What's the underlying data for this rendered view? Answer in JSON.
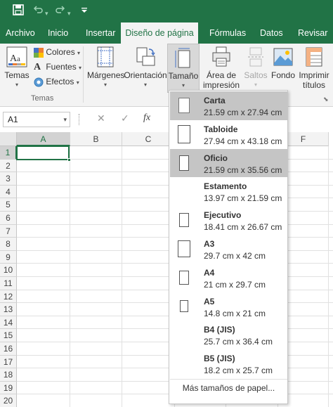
{
  "qat": {
    "save_icon": "save-icon",
    "undo_icon": "undo-icon",
    "redo_icon": "redo-icon",
    "customize_icon": "customize-icon"
  },
  "tabs": [
    "Archivo",
    "Inicio",
    "Insertar",
    "Diseño de página",
    "Fórmulas",
    "Datos",
    "Revisar"
  ],
  "active_tab": "Diseño de página",
  "ribbon": {
    "temas": {
      "label": "Temas"
    },
    "colores": "Colores",
    "fuentes": "Fuentes",
    "efectos": "Efectos",
    "group_temas": "Temas",
    "margenes": "Márgenes",
    "orientacion": "Orientación",
    "tamano": "Tamaño",
    "area_line1": "Área de",
    "area_line2": "impresión",
    "saltos": "Saltos",
    "fondo": "Fondo",
    "imprimir_line1": "Imprimir",
    "imprimir_line2": "títulos"
  },
  "formula_bar": {
    "name_box": "A1",
    "fx": "fx",
    "cancel": "✕",
    "enter": "✓"
  },
  "columns": [
    "A",
    "B",
    "C",
    "D",
    "E",
    "F"
  ],
  "rows": [
    "1",
    "2",
    "3",
    "4",
    "5",
    "6",
    "7",
    "8",
    "9",
    "10",
    "11",
    "12",
    "13",
    "14",
    "15",
    "16",
    "17",
    "18",
    "19",
    "20"
  ],
  "selected_cell": "A1",
  "dropdown": {
    "items": [
      {
        "name": "Carta",
        "dims": "21.59 cm x 27.94 cm"
      },
      {
        "name": "Tabloide",
        "dims": "27.94 cm x 43.18 cm"
      },
      {
        "name": "Oficio",
        "dims": "21.59 cm x 35.56 cm"
      },
      {
        "name": "Estamento",
        "dims": "13.97 cm x 21.59 cm"
      },
      {
        "name": "Ejecutivo",
        "dims": "18.41 cm x 26.67 cm"
      },
      {
        "name": "A3",
        "dims": "29.7 cm x 42 cm"
      },
      {
        "name": "A4",
        "dims": "21 cm x 29.7 cm"
      },
      {
        "name": "A5",
        "dims": "14.8 cm x 21 cm"
      },
      {
        "name": "B4 (JIS)",
        "dims": "25.7 cm x 36.4 cm"
      },
      {
        "name": "B5 (JIS)",
        "dims": "18.2 cm x 25.7 cm"
      }
    ],
    "selected": "Carta",
    "hovered": "Oficio",
    "more": "Más tamaños de papel..."
  },
  "colors": {
    "accent": "#217346",
    "ribbon": "#f3f3f3"
  }
}
